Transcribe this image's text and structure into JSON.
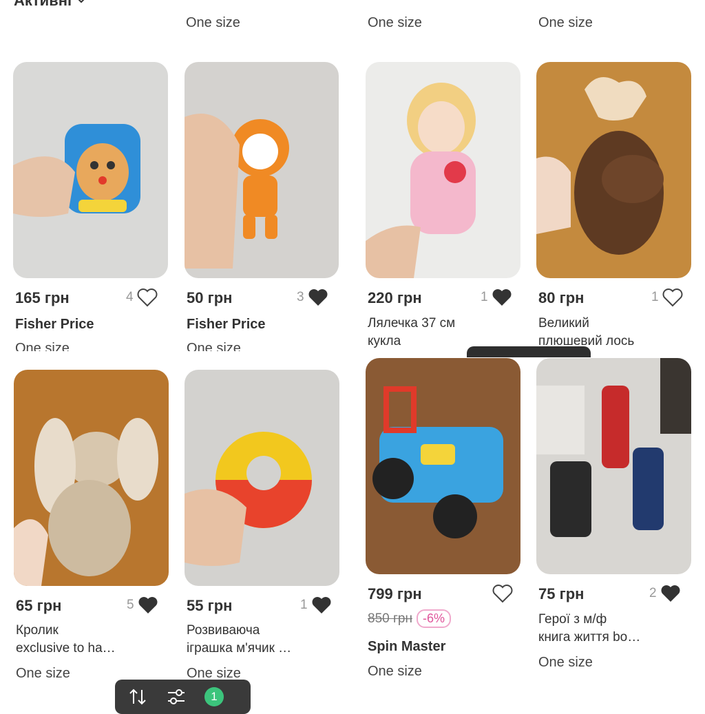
{
  "header": {
    "status_filter": "Активні",
    "chevron_icon": "chevron-down-icon"
  },
  "top_row_sizes": [
    "One size",
    "One size",
    "One size"
  ],
  "colors": {
    "discount": "#e0559b",
    "badge": "#3cc47c",
    "heart_filled": "#333333"
  },
  "items": [
    {
      "price": "165 грн",
      "likes": "4",
      "liked": false,
      "brand": "Fisher Price",
      "size": "One size"
    },
    {
      "price": "50 грн",
      "likes": "3",
      "liked": true,
      "brand": "Fisher Price",
      "size": "One size"
    },
    {
      "price": "220 грн",
      "likes": "1",
      "liked": true,
      "title_line1": "Лялечка 37 см",
      "title_line2": "кукла"
    },
    {
      "price": "80 грн",
      "likes": "1",
      "liked": false,
      "title_line1": "Великий",
      "title_line2": "плюшевий лось"
    },
    {
      "price": "65 грн",
      "likes": "5",
      "liked": true,
      "title_line1": "Кролик",
      "title_line2": "exclusive to ha…",
      "size": "One size"
    },
    {
      "price": "55 грн",
      "likes": "1",
      "liked": true,
      "title_line1": "Розвиваюча",
      "title_line2": "іграшка м'ячик …",
      "size": "One size"
    },
    {
      "price": "799 грн",
      "likes": "",
      "liked": false,
      "old_price": "850 грн",
      "discount": "-6%",
      "brand": "Spin Master",
      "size": "One size"
    },
    {
      "price": "75 грн",
      "likes": "2",
      "liked": true,
      "title_line1": "Герої з м/ф",
      "title_line2": "книга життя bo…",
      "size": "One size"
    }
  ],
  "toolbar": {
    "sort_icon": "sort-icon",
    "filter_icon": "filter-icon",
    "filter_count": "1"
  }
}
